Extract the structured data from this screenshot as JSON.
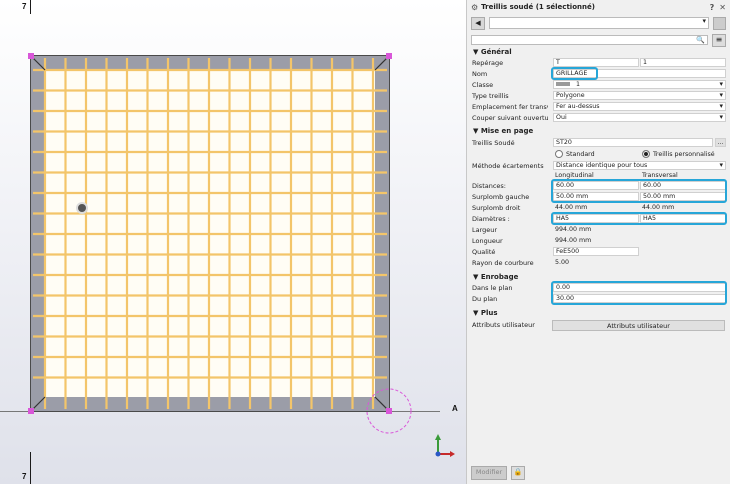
{
  "viewport": {
    "grid_label_top": "7",
    "grid_label_bottom": "7",
    "grid_label_right": "A",
    "mesh_colors": {
      "bar": "#f3c56a",
      "cell": "#fffdf5",
      "overhang": "#9b9da8",
      "frame": "#4a4a4a",
      "handle": "#d957d9"
    }
  },
  "panel": {
    "title": "Treillis soudé (1 sélectionné)",
    "help_icon": "?",
    "close_icon": "✕",
    "back_icon": "◀",
    "search_icon": "🔍",
    "menu_icon": "≡",
    "sections": {
      "general": "▼ Général",
      "layout": "▼ Mise en page",
      "cover": "▼ Enrobage",
      "more": "▼ Plus"
    },
    "general": {
      "reperage_label": "Repérage",
      "reperage_prefix": "T",
      "reperage_num": "1",
      "nom_label": "Nom",
      "nom_value": "GRILLAGE",
      "classe_label": "Classe",
      "classe_value": "1",
      "type_label": "Type treillis",
      "type_value": "Polygone",
      "emplacement_label": "Emplacement fer transve...",
      "emplacement_value": "Fer au-dessus",
      "couper_label": "Couper suivant ouverture",
      "couper_value": "Oui"
    },
    "layout": {
      "treillis_label": "Treillis Soudé",
      "treillis_value": "ST20",
      "more_btn": "...",
      "radio_standard": "Standard",
      "radio_perso": "Treillis personnalisé",
      "methode_label": "Méthode écartements",
      "methode_value": "Distance identique pour tous",
      "col_long": "Longitudinal",
      "col_trans": "Transversal",
      "distances_label": "Distances:",
      "distances_long": "60.00",
      "distances_trans": "60.00",
      "surplomb_g_label": "Surplomb gauche",
      "surplomb_g_long": "50.00 mm",
      "surplomb_g_trans": "50.00 mm",
      "surplomb_d_label": "Surplomb droit",
      "surplomb_d_long": "44.00 mm",
      "surplomb_d_trans": "44.00 mm",
      "diam_label": "Diamètres :",
      "diam_long": "HA5",
      "diam_trans": "HA5",
      "largeur_label": "Largeur",
      "largeur_value": "994.00 mm",
      "longueur_label": "Longueur",
      "longueur_value": "994.00 mm",
      "qualite_label": "Qualité",
      "qualite_value": "FeE500",
      "rayon_label": "Rayon de courbure",
      "rayon_value": "5.00"
    },
    "cover": {
      "dans_label": "Dans le plan",
      "dans_value": "0.00",
      "du_label": "Du plan",
      "du_value": "30.00"
    },
    "more": {
      "attr_label": "Attributs utilisateur",
      "attr_btn": "Attributs utilisateur"
    },
    "footer": {
      "modify_btn": "Modifier",
      "lock_icon": "🔒"
    }
  }
}
